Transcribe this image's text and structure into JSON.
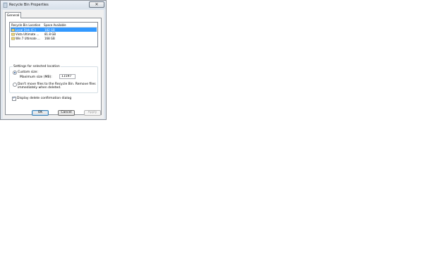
{
  "window": {
    "title": "Recycle Bin Properties",
    "close_glyph": "✕"
  },
  "tabs": [
    {
      "label": "General"
    }
  ],
  "list": {
    "headers": {
      "location": "Recycle Bin Location",
      "space": "Space Available"
    },
    "rows": [
      {
        "name": "Local Disk (C:)",
        "space": "182 GB",
        "selected": true
      },
      {
        "name": "Vista Ultimate ...",
        "space": "81.8 GB",
        "selected": false
      },
      {
        "name": "Win 7 Ultimate ...",
        "space": "168 GB",
        "selected": false
      }
    ]
  },
  "settings": {
    "group_label": "Settings for selected location",
    "custom_size_label": "Custom size:",
    "max_size_label": "Maximum size (MB):",
    "max_size_value": "11597",
    "no_move_label_line1": "Don't move files to the Recycle Bin. Remove files",
    "no_move_label_line2": "immediately when deleted."
  },
  "confirm_label": "Display delete confirmation dialog",
  "buttons": {
    "ok": "OK",
    "cancel": "Cancel",
    "apply": "Apply"
  },
  "colors": {
    "selection": "#3399ff",
    "window_frame": "#dfe6ee"
  },
  "icons": {
    "title": "recycle-bin-icon",
    "drive": "drive-icon"
  }
}
